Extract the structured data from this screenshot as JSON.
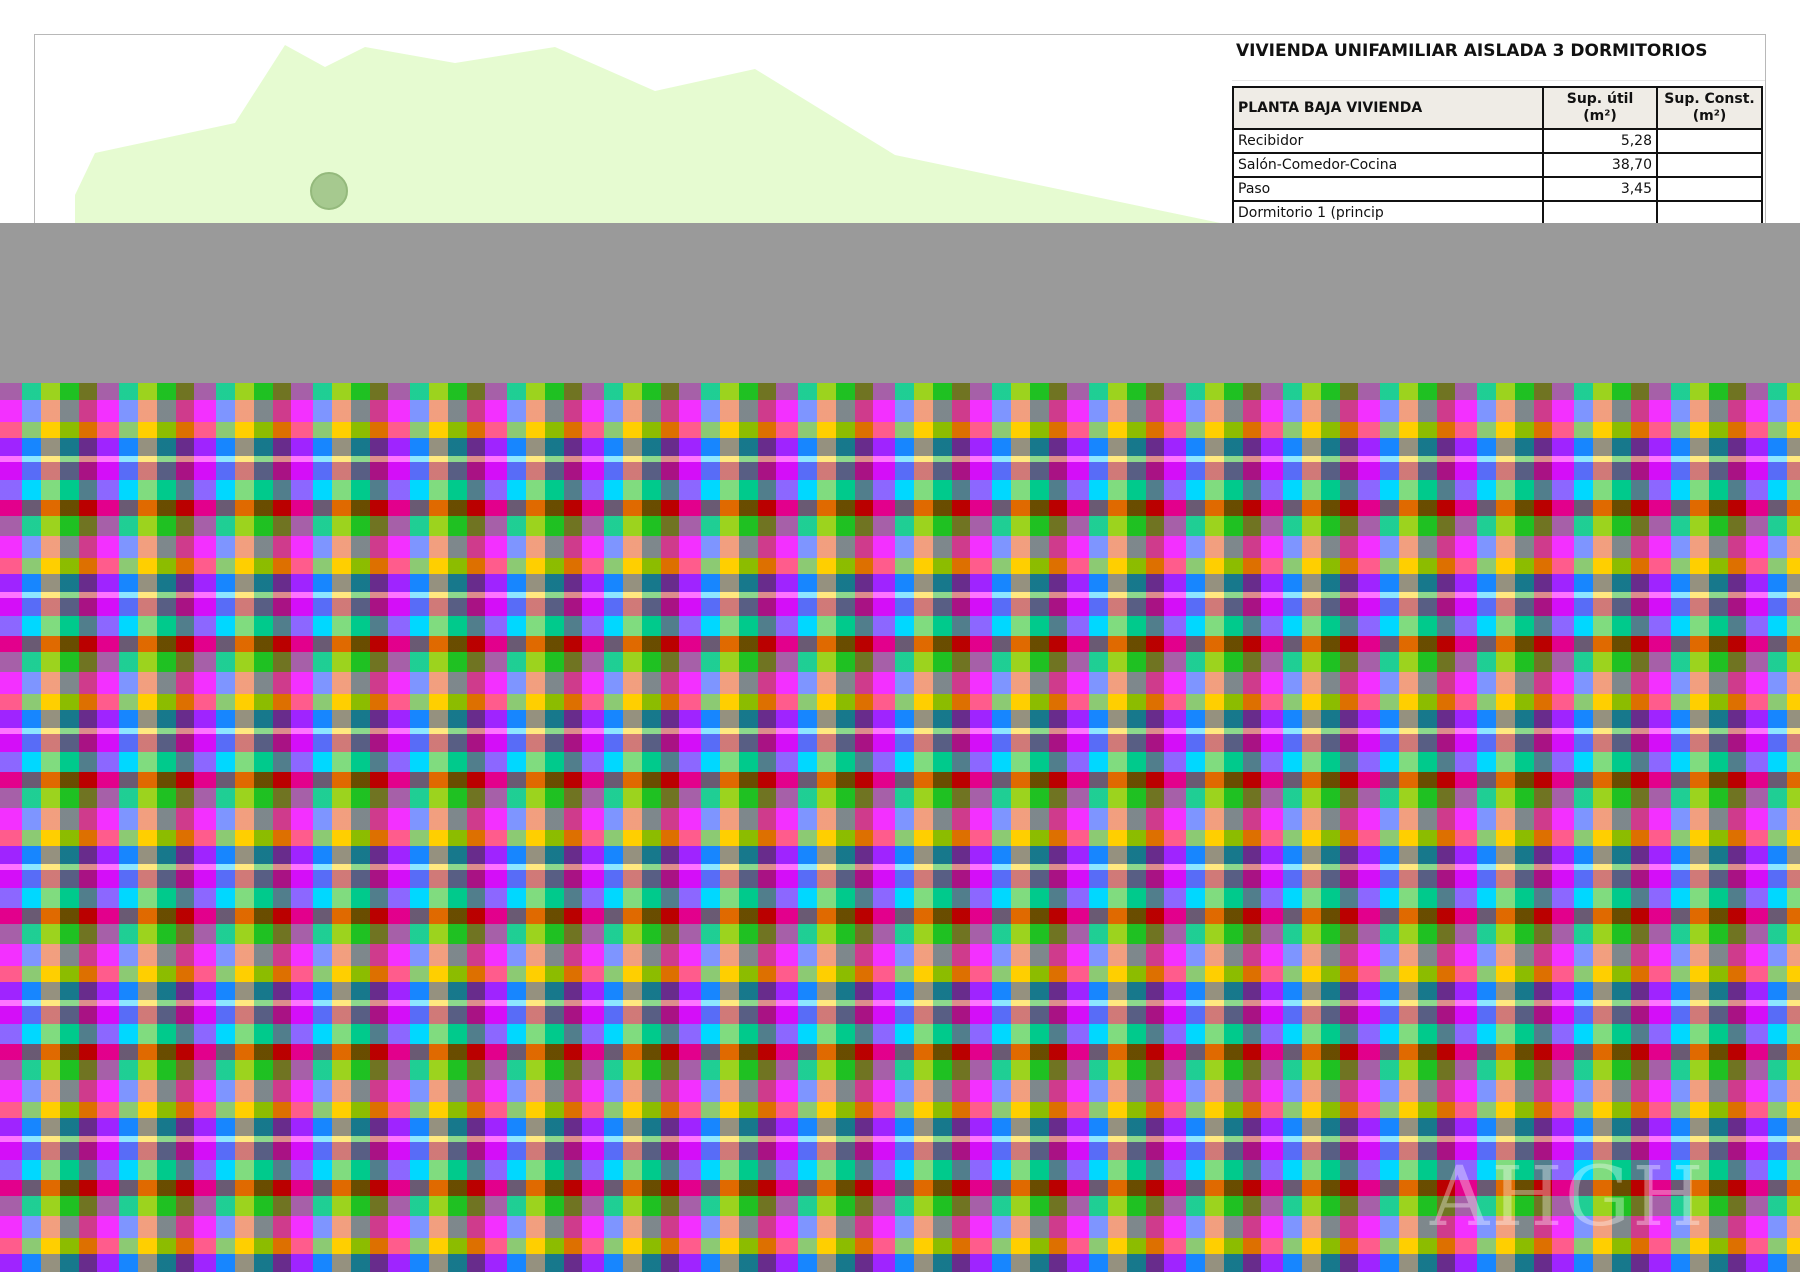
{
  "table": {
    "title": "VIVIENDA UNIFAMILIAR AISLADA 3 DORMITORIOS",
    "header": {
      "section": "PLANTA BAJA VIVIENDA",
      "useful": "Sup. útil\n(m²)",
      "built": "Sup. Const.\n(m²)"
    },
    "rows": [
      {
        "room": "Recibidor",
        "useful": "5,28",
        "built": ""
      },
      {
        "room": "Salón-Comedor-Cocina",
        "useful": "38,70",
        "built": ""
      },
      {
        "room": "Paso",
        "useful": "3,45",
        "built": ""
      },
      {
        "room": "Dormitorio 1 (princip",
        "useful": "",
        "built": ""
      }
    ]
  },
  "watermark": "AHGH",
  "colors": {
    "lawn": "#e6fbd1",
    "tree": "#a6c98f",
    "header_bg": "#efece6",
    "gray_band": "#9a9a9a"
  }
}
